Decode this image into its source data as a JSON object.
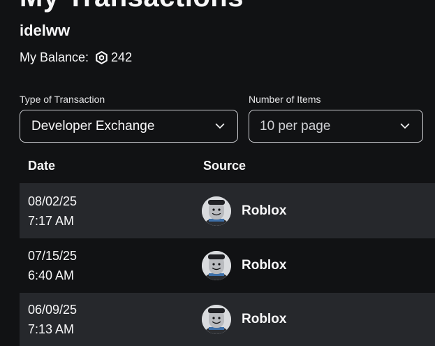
{
  "header": {
    "title": "My Transactions",
    "username": "idelww",
    "balance_label": "My Balance:",
    "balance_value": "242",
    "balance_icon": "robux-icon"
  },
  "filters": {
    "type_label": "Type of Transaction",
    "type_value": "Developer Exchange",
    "items_label": "Number of Items",
    "items_value": "10 per page"
  },
  "table": {
    "columns": [
      "Date",
      "Source"
    ],
    "rows": [
      {
        "date": "08/02/25",
        "time": "7:17 AM",
        "source": "Roblox"
      },
      {
        "date": "07/15/25",
        "time": "6:40 AM",
        "source": "Roblox"
      },
      {
        "date": "06/09/25",
        "time": "7:13 AM",
        "source": "Roblox"
      }
    ]
  },
  "colors": {
    "background": "#111214",
    "row_shade": "#26282c",
    "text": "#f7f7f8",
    "border": "#cfd0d4"
  }
}
